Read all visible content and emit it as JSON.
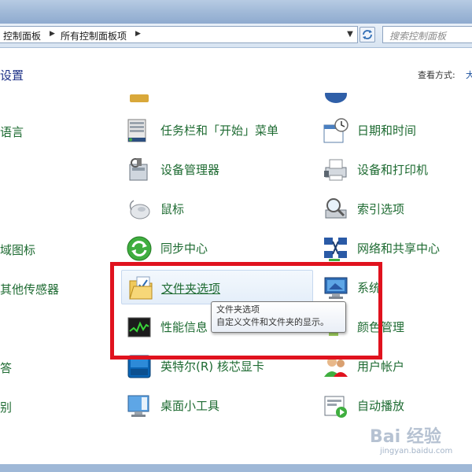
{
  "address": {
    "crumbs": [
      "控制面板",
      "所有控制面板项"
    ]
  },
  "search": {
    "placeholder": "搜索控制面板"
  },
  "header": {
    "title": "设置",
    "view_label": "查看方式:",
    "view_value": "大"
  },
  "left_column": [
    {
      "label": "语言"
    },
    {
      "label": "域图标"
    },
    {
      "label": "其他传感器"
    },
    {
      "label": "答"
    },
    {
      "label": "别"
    }
  ],
  "middle_column": [
    {
      "label": "任务栏和「开始」菜单",
      "icon": "taskbar-icon"
    },
    {
      "label": "设备管理器",
      "icon": "device-manager-icon"
    },
    {
      "label": "鼠标",
      "icon": "mouse-icon"
    },
    {
      "label": "同步中心",
      "icon": "sync-icon"
    },
    {
      "label": "文件夹选项",
      "icon": "folder-options-icon"
    },
    {
      "label": "性能信息",
      "icon": "performance-icon"
    },
    {
      "label": "英特尔(R) 核芯显卡",
      "icon": "intel-graphics-icon"
    },
    {
      "label": "桌面小工具",
      "icon": "gadgets-icon"
    }
  ],
  "right_column": [
    {
      "label": "日期和时间",
      "icon": "calendar-clock-icon"
    },
    {
      "label": "设备和打印机",
      "icon": "printer-icon"
    },
    {
      "label": "索引选项",
      "icon": "indexing-icon"
    },
    {
      "label": "网络和共享中心",
      "icon": "network-icon"
    },
    {
      "label": "系统",
      "icon": "system-icon"
    },
    {
      "label": "颜色管理",
      "icon": "color-management-icon"
    },
    {
      "label": "用户帐户",
      "icon": "user-accounts-icon"
    },
    {
      "label": "自动播放",
      "icon": "autoplay-icon"
    }
  ],
  "tooltip": {
    "title": "文件夹选项",
    "description": "自定义文件和文件夹的显示。"
  },
  "watermark": {
    "text": "Bai 经验",
    "url": "jingyan.baidu.com"
  },
  "colors": {
    "link": "#1e6b32",
    "title": "#1e3287",
    "highlight": "#e0121e"
  }
}
